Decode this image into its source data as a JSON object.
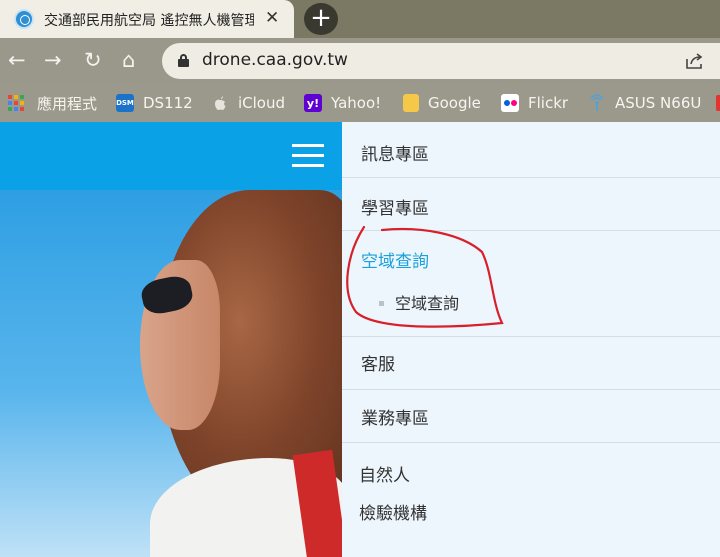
{
  "browser": {
    "tab_title": "交通部民用航空局 遙控無人機管理",
    "tab_close": "✕",
    "new_tab": "+",
    "url": "drone.caa.gov.tw",
    "nav": {
      "back": "←",
      "forward": "→",
      "reload": "↻",
      "home": "⌂"
    }
  },
  "bookmarks": [
    {
      "label": "應用程式",
      "icon": "apps-grid-icon"
    },
    {
      "label": "DS112",
      "icon": "dsm-icon",
      "icon_text": "DSM",
      "color": "#1b73c9"
    },
    {
      "label": "iCloud",
      "icon": "apple-icon"
    },
    {
      "label": "Yahoo!",
      "icon": "yahoo-icon",
      "icon_text": "y!",
      "color": "#5f01d1"
    },
    {
      "label": "Google",
      "icon": "folder-icon",
      "color": "#f6c84a"
    },
    {
      "label": "Flickr",
      "icon": "flickr-icon"
    },
    {
      "label": "ASUS N66U",
      "icon": "wifi-router-icon"
    }
  ],
  "site": {
    "header_color": "#0ba1e6"
  },
  "menu": {
    "items": [
      {
        "label": "訊息專區"
      },
      {
        "label": "學習專區"
      },
      {
        "label": "空域查詢",
        "active": true
      },
      {
        "label": "客服"
      },
      {
        "label": "業務專區"
      }
    ],
    "sub_items": [
      {
        "label": "空域查詢"
      }
    ],
    "plain_items": [
      {
        "label": "自然人"
      },
      {
        "label": "檢驗機構"
      }
    ],
    "active_color": "#1aa0dc",
    "annotation_color": "#d8202a"
  }
}
